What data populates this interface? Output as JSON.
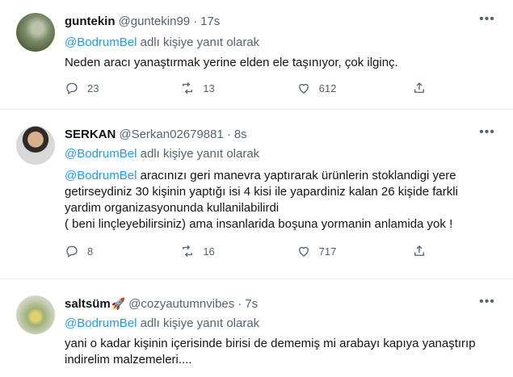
{
  "tweets": [
    {
      "name": "guntekin",
      "handle": "@guntekin99",
      "time": "17s",
      "reply_prefix": "@BodrumBel",
      "reply_suffix": "adlı kişiye yanıt olarak",
      "lines": [
        "Neden aracı yanaştırmak yerine elden ele taşınıyor, çok ilginç."
      ],
      "replies": "23",
      "retweets": "13",
      "likes": "612"
    },
    {
      "name": "SERKAN",
      "handle": "@Serkan02679881",
      "time": "8s",
      "reply_prefix": "@BodrumBel",
      "reply_suffix": "adlı kişiye yanıt olarak",
      "lines_first_mention": "@BodrumBel",
      "lines_first_rest": " aracınızı geri manevra yaptırarak ürünlerin stoklandigi yere",
      "lines": [
        "getirseydiniz 30 kişinin yaptığı isi 4 kisi ile yapardiniz kalan 26 kişide farkli",
        "yardim organizasyonunda kullanilabilirdi",
        "( beni linçleyebilirsiniz) ama insanlarida boşuna yormanin anlamida yok !"
      ],
      "replies": "8",
      "retweets": "16",
      "likes": "717"
    },
    {
      "name": "saltsüm",
      "name_emoji": "🚀",
      "handle": "@cozyautumnvibes",
      "time": "7s",
      "reply_prefix": "@BodrumBel",
      "reply_suffix": "adlı kişiye yanıt olarak",
      "lines": [
        "yani o kadar kişinin içerisinde birisi de dememiş mi arabayı kapıya yanaştırıp",
        "indirelim malzemeleri...."
      ]
    }
  ],
  "icons": {
    "more": "more-icon",
    "reply": "reply-icon",
    "retweet": "retweet-icon",
    "like": "like-icon",
    "share": "share-icon"
  },
  "colors": {
    "mention": "#1d9bf0",
    "secondary_text": "#536471",
    "divider": "#e6ecf0"
  }
}
